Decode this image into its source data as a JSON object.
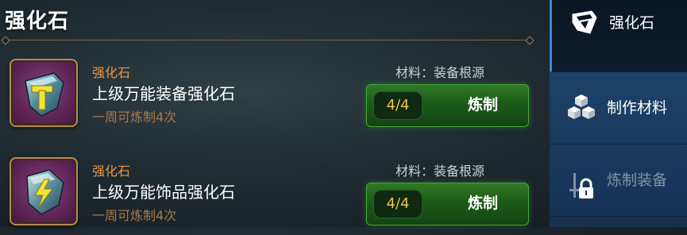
{
  "header": {
    "title": "强化石"
  },
  "items": [
    {
      "type": "强化石",
      "name": "上级万能装备强化石",
      "limit": "一周可炼制4次",
      "material": "材料：装备根源",
      "count": "4/4",
      "action_label": "炼制",
      "icon": "hammer-stone-icon"
    },
    {
      "type": "强化石",
      "name": "上级万能饰品强化石",
      "limit": "一周可炼制4次",
      "material": "材料：装备根源",
      "count": "4/4",
      "action_label": "炼制",
      "icon": "lightning-stone-icon"
    }
  ],
  "sidebar": {
    "tabs": [
      {
        "label": "强化石",
        "icon": "gem-icon",
        "active": true,
        "locked": false
      },
      {
        "label": "制作材料",
        "icon": "cubes-icon",
        "active": false,
        "locked": false
      },
      {
        "label": "炼制装备",
        "icon": "locked-sword-icon",
        "active": false,
        "locked": true
      }
    ]
  },
  "colors": {
    "accent_orange": "#e8964a",
    "button_green": "#2f7a25",
    "count_yellow": "#f0c24a",
    "sidebar_blue": "#1c3858"
  }
}
